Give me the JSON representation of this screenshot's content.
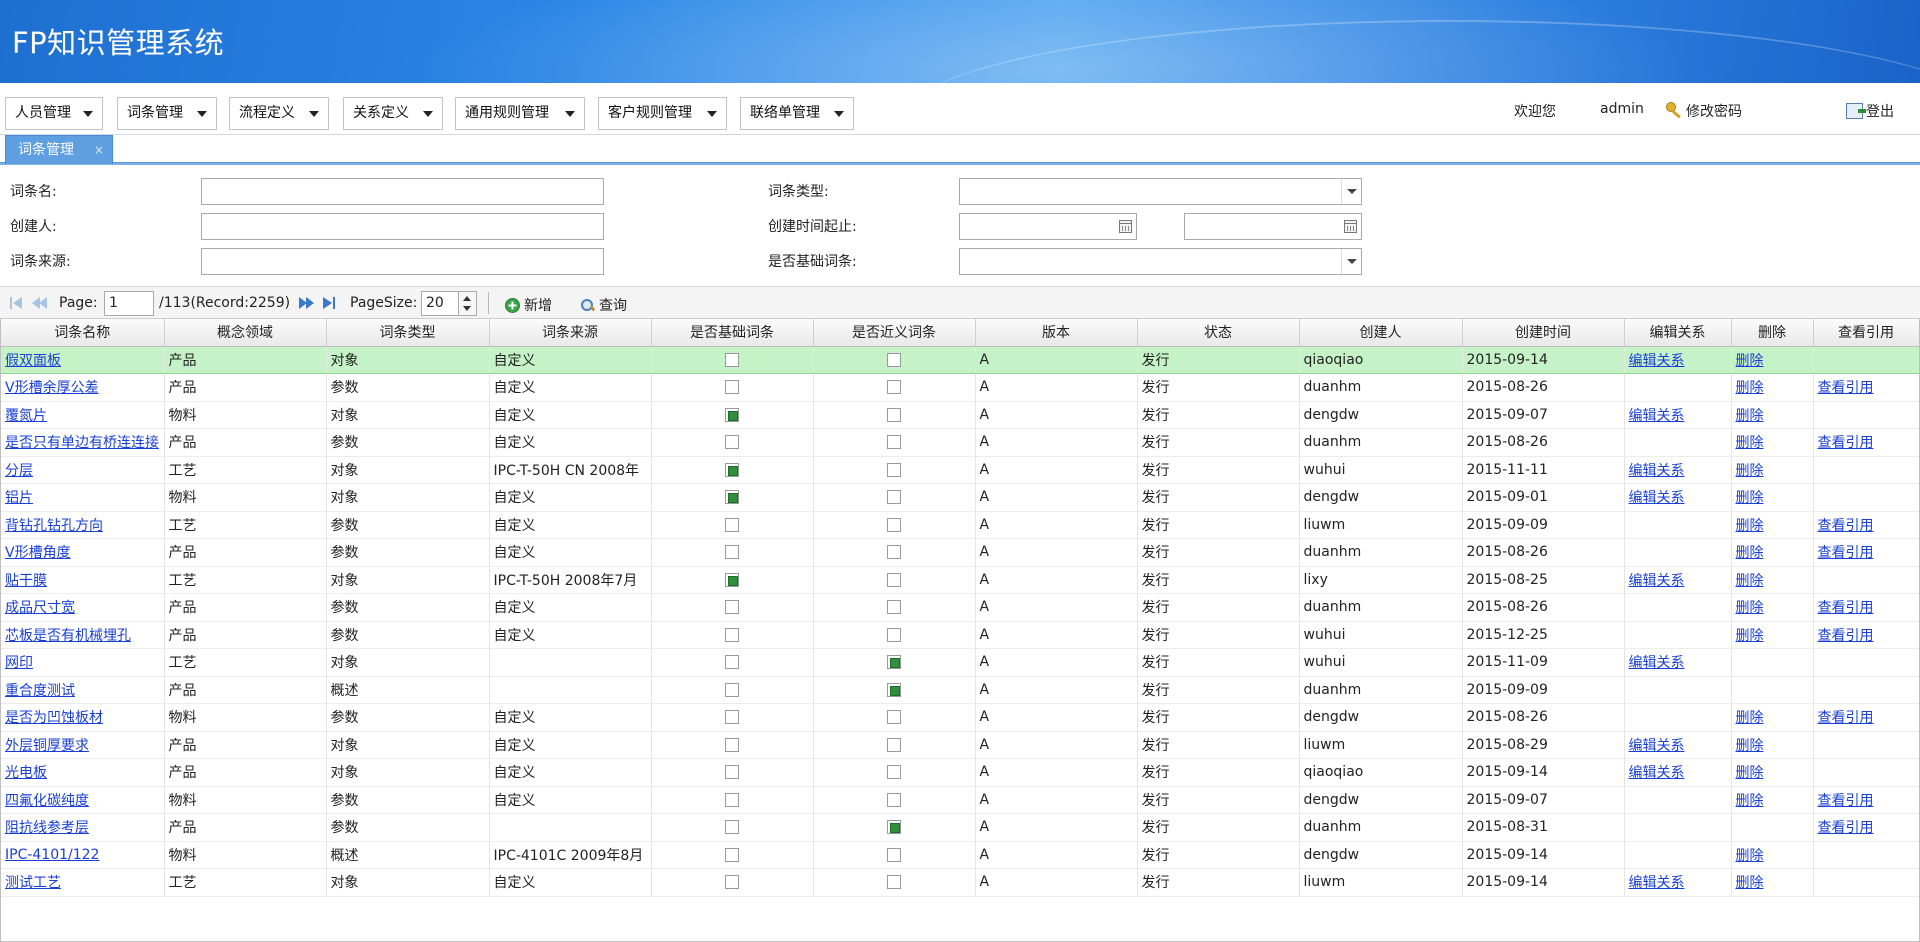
{
  "app": {
    "title": "FP知识管理系统"
  },
  "menu": [
    {
      "label": "人员管理"
    },
    {
      "label": "词条管理"
    },
    {
      "label": "流程定义"
    },
    {
      "label": "关系定义"
    },
    {
      "label": "通用规则管理"
    },
    {
      "label": "客户规则管理"
    },
    {
      "label": "联络单管理"
    }
  ],
  "user": {
    "welcome": "欢迎您",
    "name": "admin",
    "change_password": "修改密码",
    "logout": "登出"
  },
  "tab": {
    "label": "词条管理",
    "close": "×"
  },
  "search": {
    "term_name": {
      "label": "词条名:",
      "value": ""
    },
    "creator": {
      "label": "创建人:",
      "value": ""
    },
    "source": {
      "label": "词条来源:",
      "value": ""
    },
    "term_type": {
      "label": "词条类型:",
      "value": ""
    },
    "created_range": {
      "label": "创建时间起止:",
      "from": "",
      "to": ""
    },
    "is_basic": {
      "label": "是否基础词条:",
      "value": ""
    }
  },
  "pager": {
    "page_label": "Page:",
    "page_value": "1",
    "total": "/113(Record:2259)",
    "pagesize_label": "PageSize:",
    "pagesize_value": "20",
    "add_label": "新增",
    "query_label": "查询"
  },
  "grid": {
    "columns": [
      "词条名称",
      "概念领域",
      "词条类型",
      "词条来源",
      "是否基础词条",
      "是否近义词条",
      "版本",
      "状态",
      "创建人",
      "创建时间",
      "编辑关系",
      "删除",
      "查看引用"
    ],
    "rows": [
      {
        "name": "假双面板",
        "domain": "产品",
        "type": "对象",
        "source": "自定义",
        "basic": false,
        "synonym": false,
        "version": "A",
        "status": "发行",
        "creator": "qiaoqiao",
        "created": "2015-09-14",
        "edit": "编辑关系",
        "del": "删除",
        "ref": ""
      },
      {
        "name": "V形槽余厚公差",
        "domain": "产品",
        "type": "参数",
        "source": "自定义",
        "basic": false,
        "synonym": false,
        "version": "A",
        "status": "发行",
        "creator": "duanhm",
        "created": "2015-08-26",
        "edit": "",
        "del": "删除",
        "ref": "查看引用"
      },
      {
        "name": "覆氮片",
        "domain": "物料",
        "type": "对象",
        "source": "自定义",
        "basic": true,
        "synonym": false,
        "version": "A",
        "status": "发行",
        "creator": "dengdw",
        "created": "2015-09-07",
        "edit": "编辑关系",
        "del": "删除",
        "ref": ""
      },
      {
        "name": "是否只有单边有桥连连接",
        "domain": "产品",
        "type": "参数",
        "source": "自定义",
        "basic": false,
        "synonym": false,
        "version": "A",
        "status": "发行",
        "creator": "duanhm",
        "created": "2015-08-26",
        "edit": "",
        "del": "删除",
        "ref": "查看引用"
      },
      {
        "name": "分层",
        "domain": "工艺",
        "type": "对象",
        "source": "IPC-T-50H CN 2008年",
        "basic": true,
        "synonym": false,
        "version": "A",
        "status": "发行",
        "creator": "wuhui",
        "created": "2015-11-11",
        "edit": "编辑关系",
        "del": "删除",
        "ref": ""
      },
      {
        "name": "铝片",
        "domain": "物料",
        "type": "对象",
        "source": "自定义",
        "basic": true,
        "synonym": false,
        "version": "A",
        "status": "发行",
        "creator": "dengdw",
        "created": "2015-09-01",
        "edit": "编辑关系",
        "del": "删除",
        "ref": ""
      },
      {
        "name": "背钻孔钻孔方向",
        "domain": "工艺",
        "type": "参数",
        "source": "自定义",
        "basic": false,
        "synonym": false,
        "version": "A",
        "status": "发行",
        "creator": "liuwm",
        "created": "2015-09-09",
        "edit": "",
        "del": "删除",
        "ref": "查看引用"
      },
      {
        "name": "V形槽角度",
        "domain": "产品",
        "type": "参数",
        "source": "自定义",
        "basic": false,
        "synonym": false,
        "version": "A",
        "status": "发行",
        "creator": "duanhm",
        "created": "2015-08-26",
        "edit": "",
        "del": "删除",
        "ref": "查看引用"
      },
      {
        "name": "贴干膜",
        "domain": "工艺",
        "type": "对象",
        "source": "IPC-T-50H 2008年7月",
        "basic": true,
        "synonym": false,
        "version": "A",
        "status": "发行",
        "creator": "lixy",
        "created": "2015-08-25",
        "edit": "编辑关系",
        "del": "删除",
        "ref": ""
      },
      {
        "name": "成品尺寸宽",
        "domain": "产品",
        "type": "参数",
        "source": "自定义",
        "basic": false,
        "synonym": false,
        "version": "A",
        "status": "发行",
        "creator": "duanhm",
        "created": "2015-08-26",
        "edit": "",
        "del": "删除",
        "ref": "查看引用"
      },
      {
        "name": "芯板是否有机械埋孔",
        "domain": "产品",
        "type": "参数",
        "source": "自定义",
        "basic": false,
        "synonym": false,
        "version": "A",
        "status": "发行",
        "creator": "wuhui",
        "created": "2015-12-25",
        "edit": "",
        "del": "删除",
        "ref": "查看引用"
      },
      {
        "name": "网印",
        "domain": "工艺",
        "type": "对象",
        "source": "",
        "basic": false,
        "synonym": true,
        "version": "A",
        "status": "发行",
        "creator": "wuhui",
        "created": "2015-11-09",
        "edit": "编辑关系",
        "del": "",
        "ref": ""
      },
      {
        "name": "重合度测试",
        "domain": "产品",
        "type": "概述",
        "source": "",
        "basic": false,
        "synonym": true,
        "version": "A",
        "status": "发行",
        "creator": "duanhm",
        "created": "2015-09-09",
        "edit": "",
        "del": "",
        "ref": ""
      },
      {
        "name": "是否为凹蚀板材",
        "domain": "物料",
        "type": "参数",
        "source": "自定义",
        "basic": false,
        "synonym": false,
        "version": "A",
        "status": "发行",
        "creator": "dengdw",
        "created": "2015-08-26",
        "edit": "",
        "del": "删除",
        "ref": "查看引用"
      },
      {
        "name": "外层铜厚要求",
        "domain": "产品",
        "type": "对象",
        "source": "自定义",
        "basic": false,
        "synonym": false,
        "version": "A",
        "status": "发行",
        "creator": "liuwm",
        "created": "2015-08-29",
        "edit": "编辑关系",
        "del": "删除",
        "ref": ""
      },
      {
        "name": "光电板",
        "domain": "产品",
        "type": "对象",
        "source": "自定义",
        "basic": false,
        "synonym": false,
        "version": "A",
        "status": "发行",
        "creator": "qiaoqiao",
        "created": "2015-09-14",
        "edit": "编辑关系",
        "del": "删除",
        "ref": ""
      },
      {
        "name": "四氟化碳纯度",
        "domain": "物料",
        "type": "参数",
        "source": "自定义",
        "basic": false,
        "synonym": false,
        "version": "A",
        "status": "发行",
        "creator": "dengdw",
        "created": "2015-09-07",
        "edit": "",
        "del": "删除",
        "ref": "查看引用"
      },
      {
        "name": "阻抗线参考层",
        "domain": "产品",
        "type": "参数",
        "source": "",
        "basic": false,
        "synonym": true,
        "version": "A",
        "status": "发行",
        "creator": "duanhm",
        "created": "2015-08-31",
        "edit": "",
        "del": "",
        "ref": "查看引用"
      },
      {
        "name": "IPC-4101/122",
        "domain": "物料",
        "type": "概述",
        "source": "IPC-4101C 2009年8月",
        "basic": false,
        "synonym": false,
        "version": "A",
        "status": "发行",
        "creator": "dengdw",
        "created": "2015-09-14",
        "edit": "",
        "del": "删除",
        "ref": ""
      },
      {
        "name": "测试工艺",
        "domain": "工艺",
        "type": "对象",
        "source": "自定义",
        "basic": false,
        "synonym": false,
        "version": "A",
        "status": "发行",
        "creator": "liuwm",
        "created": "2015-09-14",
        "edit": "编辑关系",
        "del": "删除",
        "ref": ""
      }
    ]
  }
}
